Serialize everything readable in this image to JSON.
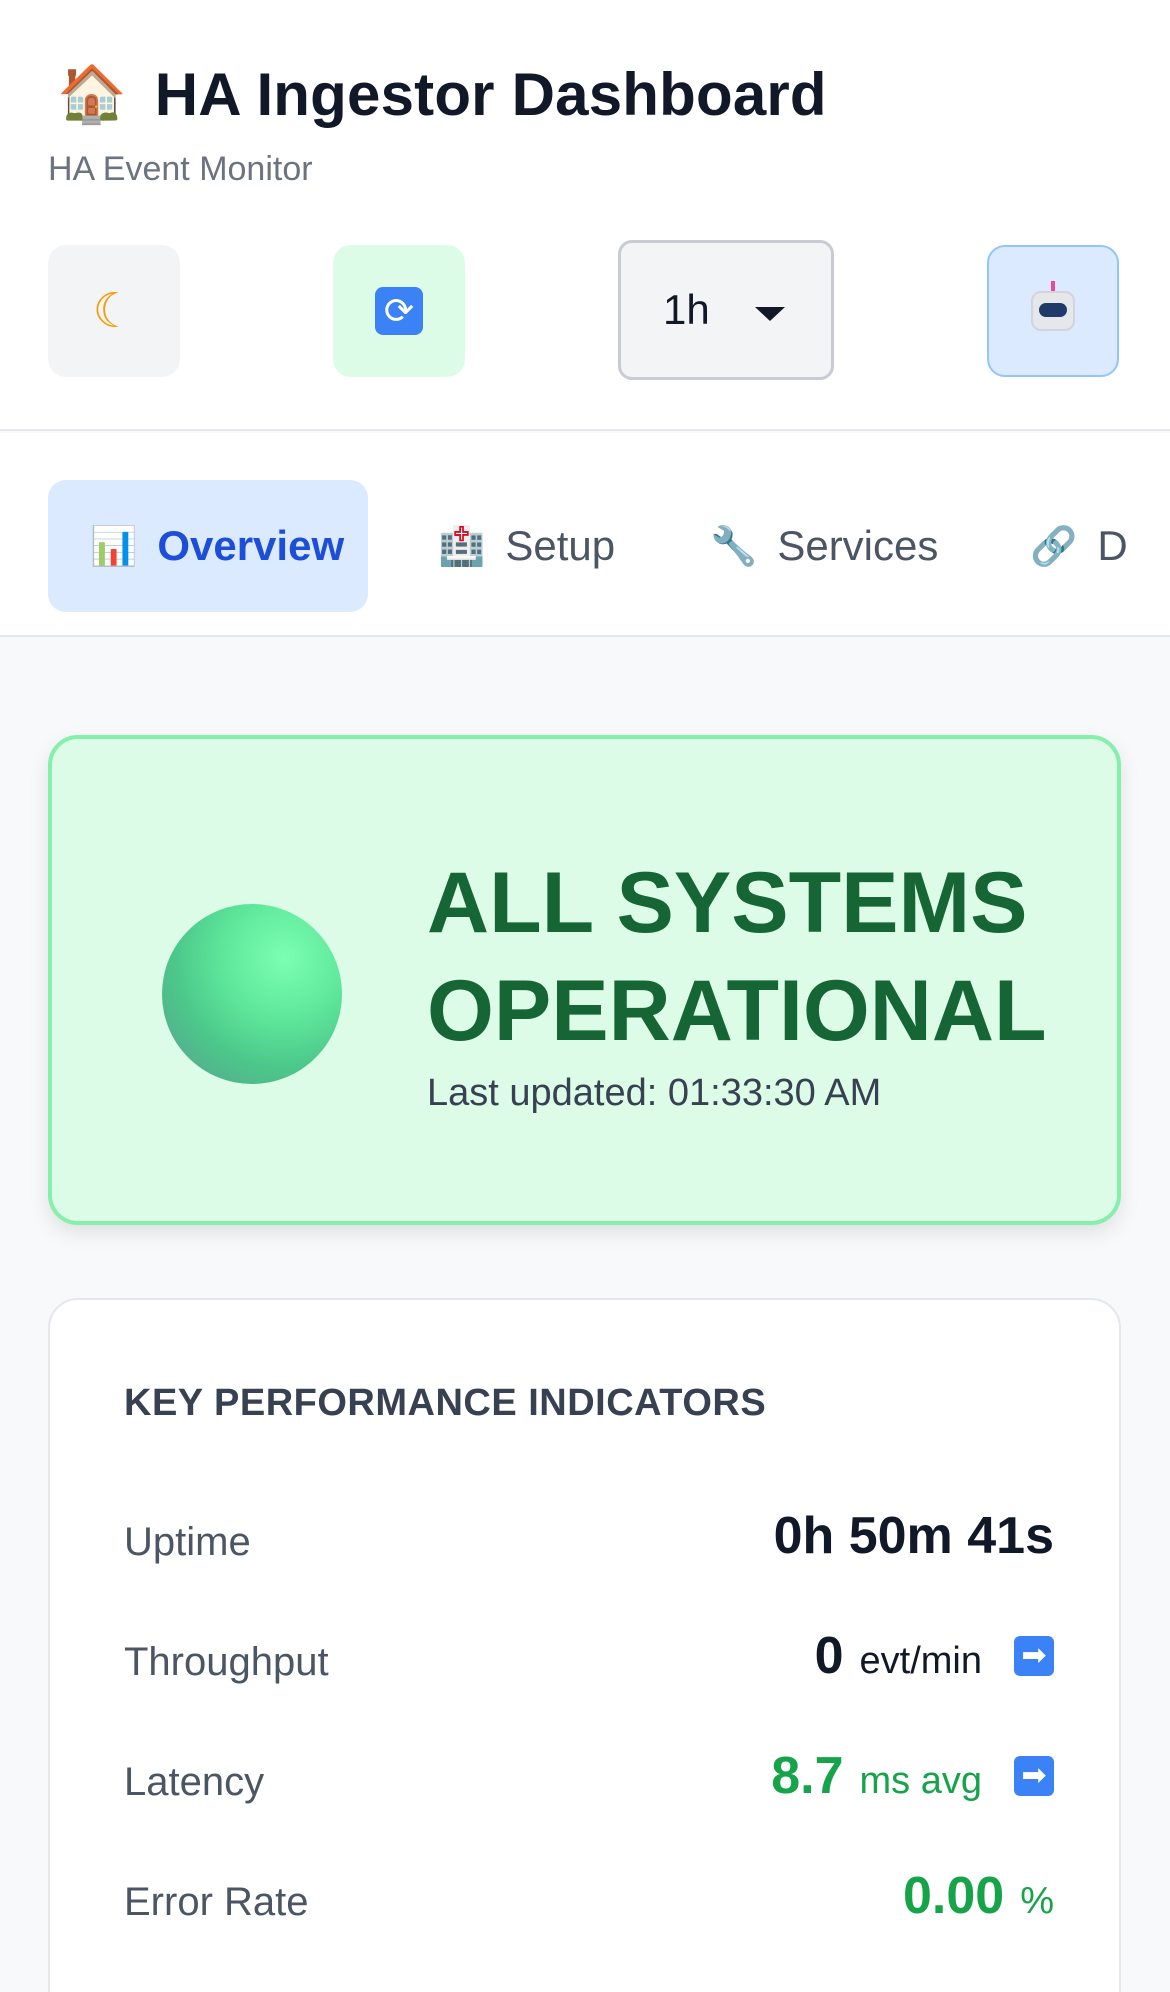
{
  "header": {
    "logo_icon": "house-icon",
    "title": "HA Ingestor Dashboard",
    "subtitle": "HA Event Monitor",
    "controls": {
      "theme_icon": "moon-icon",
      "refresh_icon": "refresh-icon",
      "time_range": "1h",
      "assistant_icon": "robot-icon"
    }
  },
  "tabs": [
    {
      "label": "Overview",
      "icon": "bar-chart-icon",
      "active": true
    },
    {
      "label": "Setup",
      "icon": "hospital-icon",
      "active": false
    },
    {
      "label": "Services",
      "icon": "wrench-icon",
      "active": false
    },
    {
      "label": "D",
      "icon": "link-icon",
      "active": false
    }
  ],
  "status": {
    "title": "ALL SYSTEMS OPERATIONAL",
    "updated_label": "Last updated:",
    "updated_time": "01:33:30 AM",
    "color": "#166534"
  },
  "kpi": {
    "heading": "KEY PERFORMANCE INDICATORS",
    "rows": [
      {
        "label": "Uptime",
        "value": "0h 50m 41s",
        "unit": ""
      },
      {
        "label": "Throughput",
        "value": "0",
        "unit": "evt/min",
        "trend_icon": "right-arrow-icon"
      },
      {
        "label": "Latency",
        "value": "8.7",
        "unit": "ms avg",
        "trend_icon": "right-arrow-icon"
      },
      {
        "label": "Error Rate",
        "value": "0.00",
        "unit": "%"
      }
    ],
    "accent_green": "#16a34a"
  }
}
